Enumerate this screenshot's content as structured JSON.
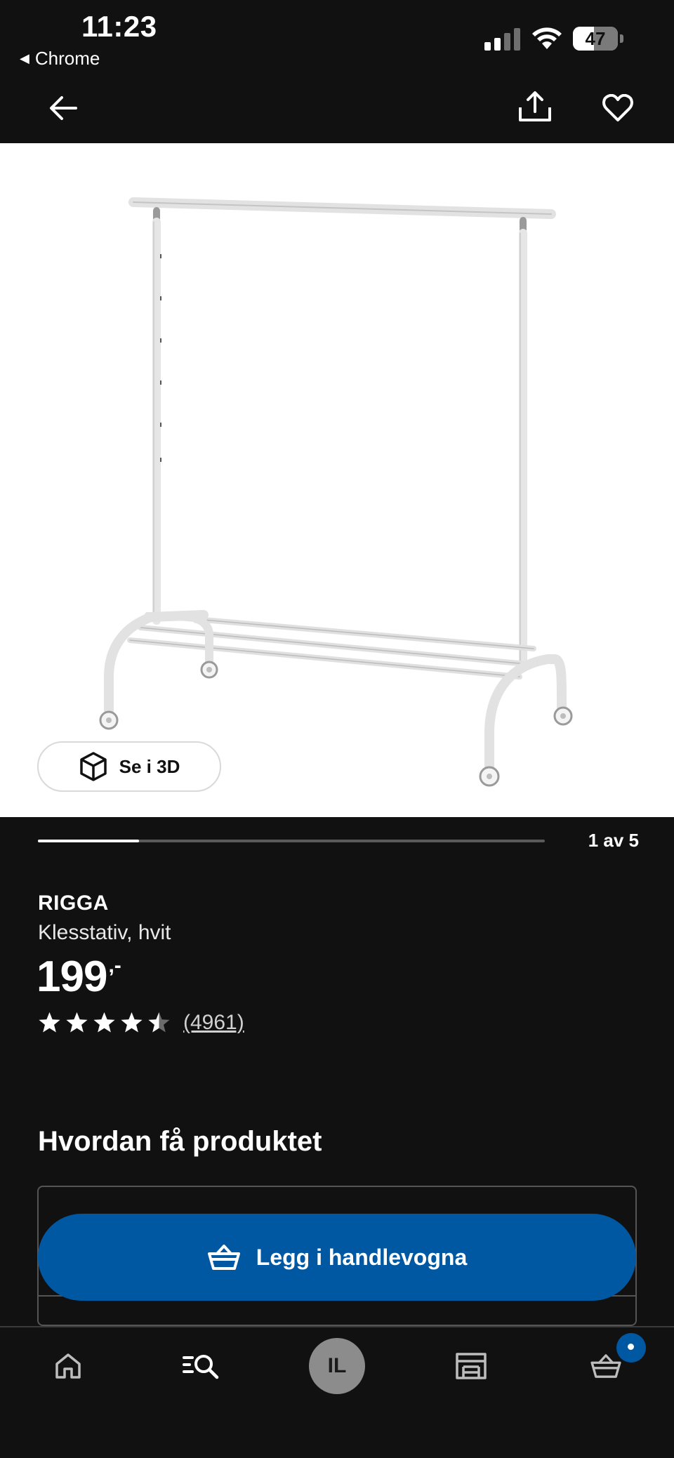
{
  "status_bar": {
    "time": "11:23",
    "back_app": "Chrome",
    "battery_level": "47",
    "battery_fraction": 0.47,
    "icons": [
      "cellular-signal-icon",
      "wifi-icon",
      "battery-icon"
    ]
  },
  "header": {
    "icons": [
      "back-arrow-icon",
      "share-icon",
      "heart-icon"
    ]
  },
  "gallery": {
    "view_3d_label": "Se i 3D",
    "page_indicator": "1 av 5",
    "current_page": 1,
    "total_pages": 5,
    "background": "#ffffff"
  },
  "product": {
    "name": "RIGGA",
    "description": "Klesstativ, hvit",
    "price_integer": "199",
    "price_suffix": ",-",
    "rating": 4.5,
    "rating_max": 5,
    "review_count": "(4961)"
  },
  "section": {
    "title": "Hvordan få produktet"
  },
  "cta": {
    "add_to_cart_label": "Legg i handlevogna",
    "color": "#0058a3"
  },
  "tab_bar": {
    "items": [
      {
        "icon": "home-icon"
      },
      {
        "icon": "search-list-icon"
      },
      {
        "icon": "profile-avatar",
        "initials": "IL"
      },
      {
        "icon": "store-icon"
      },
      {
        "icon": "cart-basket-icon"
      }
    ],
    "badge_color": "#0058a3"
  },
  "colors": {
    "background": "#111111",
    "accent": "#0058a3",
    "text": "#ffffff"
  }
}
